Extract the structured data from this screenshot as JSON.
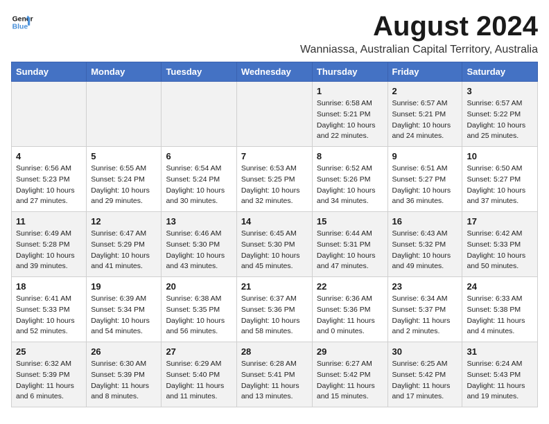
{
  "logo": {
    "line1": "General",
    "line2": "Blue"
  },
  "title": "August 2024",
  "subtitle": "Wanniassa, Australian Capital Territory, Australia",
  "days_of_week": [
    "Sunday",
    "Monday",
    "Tuesday",
    "Wednesday",
    "Thursday",
    "Friday",
    "Saturday"
  ],
  "weeks": [
    [
      {
        "num": "",
        "info": ""
      },
      {
        "num": "",
        "info": ""
      },
      {
        "num": "",
        "info": ""
      },
      {
        "num": "",
        "info": ""
      },
      {
        "num": "1",
        "info": "Sunrise: 6:58 AM\nSunset: 5:21 PM\nDaylight: 10 hours\nand 22 minutes."
      },
      {
        "num": "2",
        "info": "Sunrise: 6:57 AM\nSunset: 5:21 PM\nDaylight: 10 hours\nand 24 minutes."
      },
      {
        "num": "3",
        "info": "Sunrise: 6:57 AM\nSunset: 5:22 PM\nDaylight: 10 hours\nand 25 minutes."
      }
    ],
    [
      {
        "num": "4",
        "info": "Sunrise: 6:56 AM\nSunset: 5:23 PM\nDaylight: 10 hours\nand 27 minutes."
      },
      {
        "num": "5",
        "info": "Sunrise: 6:55 AM\nSunset: 5:24 PM\nDaylight: 10 hours\nand 29 minutes."
      },
      {
        "num": "6",
        "info": "Sunrise: 6:54 AM\nSunset: 5:24 PM\nDaylight: 10 hours\nand 30 minutes."
      },
      {
        "num": "7",
        "info": "Sunrise: 6:53 AM\nSunset: 5:25 PM\nDaylight: 10 hours\nand 32 minutes."
      },
      {
        "num": "8",
        "info": "Sunrise: 6:52 AM\nSunset: 5:26 PM\nDaylight: 10 hours\nand 34 minutes."
      },
      {
        "num": "9",
        "info": "Sunrise: 6:51 AM\nSunset: 5:27 PM\nDaylight: 10 hours\nand 36 minutes."
      },
      {
        "num": "10",
        "info": "Sunrise: 6:50 AM\nSunset: 5:27 PM\nDaylight: 10 hours\nand 37 minutes."
      }
    ],
    [
      {
        "num": "11",
        "info": "Sunrise: 6:49 AM\nSunset: 5:28 PM\nDaylight: 10 hours\nand 39 minutes."
      },
      {
        "num": "12",
        "info": "Sunrise: 6:47 AM\nSunset: 5:29 PM\nDaylight: 10 hours\nand 41 minutes."
      },
      {
        "num": "13",
        "info": "Sunrise: 6:46 AM\nSunset: 5:30 PM\nDaylight: 10 hours\nand 43 minutes."
      },
      {
        "num": "14",
        "info": "Sunrise: 6:45 AM\nSunset: 5:30 PM\nDaylight: 10 hours\nand 45 minutes."
      },
      {
        "num": "15",
        "info": "Sunrise: 6:44 AM\nSunset: 5:31 PM\nDaylight: 10 hours\nand 47 minutes."
      },
      {
        "num": "16",
        "info": "Sunrise: 6:43 AM\nSunset: 5:32 PM\nDaylight: 10 hours\nand 49 minutes."
      },
      {
        "num": "17",
        "info": "Sunrise: 6:42 AM\nSunset: 5:33 PM\nDaylight: 10 hours\nand 50 minutes."
      }
    ],
    [
      {
        "num": "18",
        "info": "Sunrise: 6:41 AM\nSunset: 5:33 PM\nDaylight: 10 hours\nand 52 minutes."
      },
      {
        "num": "19",
        "info": "Sunrise: 6:39 AM\nSunset: 5:34 PM\nDaylight: 10 hours\nand 54 minutes."
      },
      {
        "num": "20",
        "info": "Sunrise: 6:38 AM\nSunset: 5:35 PM\nDaylight: 10 hours\nand 56 minutes."
      },
      {
        "num": "21",
        "info": "Sunrise: 6:37 AM\nSunset: 5:36 PM\nDaylight: 10 hours\nand 58 minutes."
      },
      {
        "num": "22",
        "info": "Sunrise: 6:36 AM\nSunset: 5:36 PM\nDaylight: 11 hours\nand 0 minutes."
      },
      {
        "num": "23",
        "info": "Sunrise: 6:34 AM\nSunset: 5:37 PM\nDaylight: 11 hours\nand 2 minutes."
      },
      {
        "num": "24",
        "info": "Sunrise: 6:33 AM\nSunset: 5:38 PM\nDaylight: 11 hours\nand 4 minutes."
      }
    ],
    [
      {
        "num": "25",
        "info": "Sunrise: 6:32 AM\nSunset: 5:39 PM\nDaylight: 11 hours\nand 6 minutes."
      },
      {
        "num": "26",
        "info": "Sunrise: 6:30 AM\nSunset: 5:39 PM\nDaylight: 11 hours\nand 8 minutes."
      },
      {
        "num": "27",
        "info": "Sunrise: 6:29 AM\nSunset: 5:40 PM\nDaylight: 11 hours\nand 11 minutes."
      },
      {
        "num": "28",
        "info": "Sunrise: 6:28 AM\nSunset: 5:41 PM\nDaylight: 11 hours\nand 13 minutes."
      },
      {
        "num": "29",
        "info": "Sunrise: 6:27 AM\nSunset: 5:42 PM\nDaylight: 11 hours\nand 15 minutes."
      },
      {
        "num": "30",
        "info": "Sunrise: 6:25 AM\nSunset: 5:42 PM\nDaylight: 11 hours\nand 17 minutes."
      },
      {
        "num": "31",
        "info": "Sunrise: 6:24 AM\nSunset: 5:43 PM\nDaylight: 11 hours\nand 19 minutes."
      }
    ]
  ]
}
